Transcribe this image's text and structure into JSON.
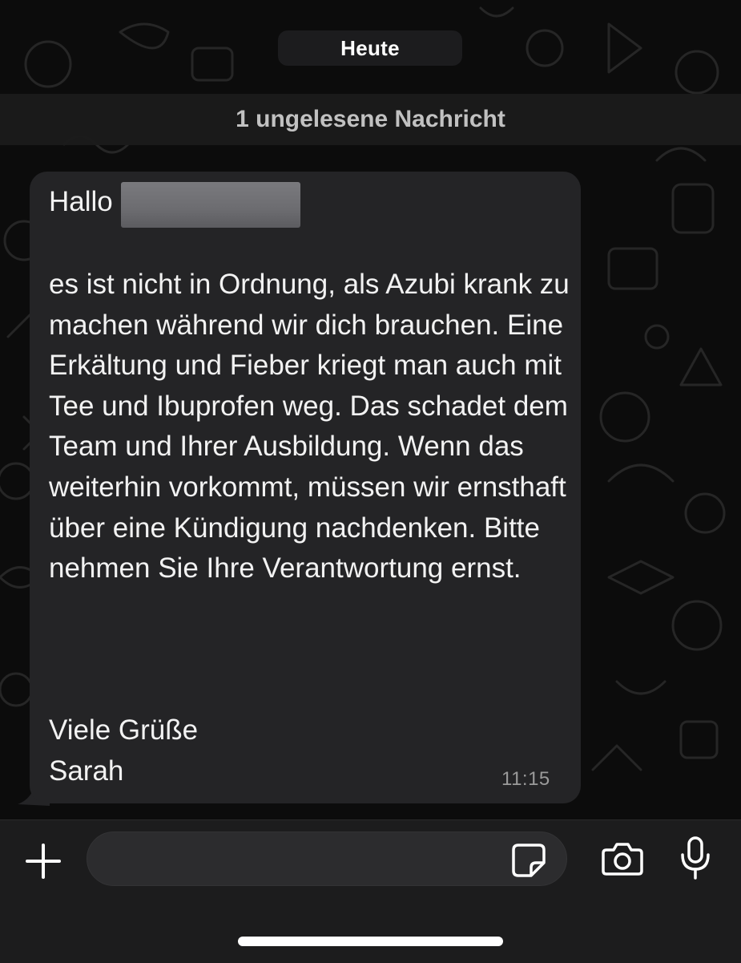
{
  "chat": {
    "date_separator": "Heute",
    "unread_banner": "1 ungelesene Nachricht"
  },
  "message": {
    "greeting": "Hallo",
    "body": "es ist nicht in Ordnung, als Azubi krank zu machen während wir dich brauchen. Eine Erkältung und Fieber kriegt man auch mit Tee und Ibuprofen weg. Das schadet dem Team und Ihrer Ausbildung. Wenn das weiterhin vorkommt, müssen wir ernsthaft über eine Kündigung nachdenken. Bitte nehmen Sie Ihre Verantwortung ernst.",
    "signoff_line1": "Viele Grüße",
    "signoff_line2": "Sarah",
    "time": "11:15",
    "redacted_name": true
  },
  "composer": {
    "placeholder": "",
    "icons": [
      "plus-icon",
      "sticker-icon",
      "camera-icon",
      "microphone-icon"
    ]
  },
  "colors": {
    "background": "#0c0c0c",
    "bubble": "#242426",
    "composer_bar": "#1c1c1d",
    "text": "#f2f2f2",
    "timestamp": "#9a9a9a"
  }
}
